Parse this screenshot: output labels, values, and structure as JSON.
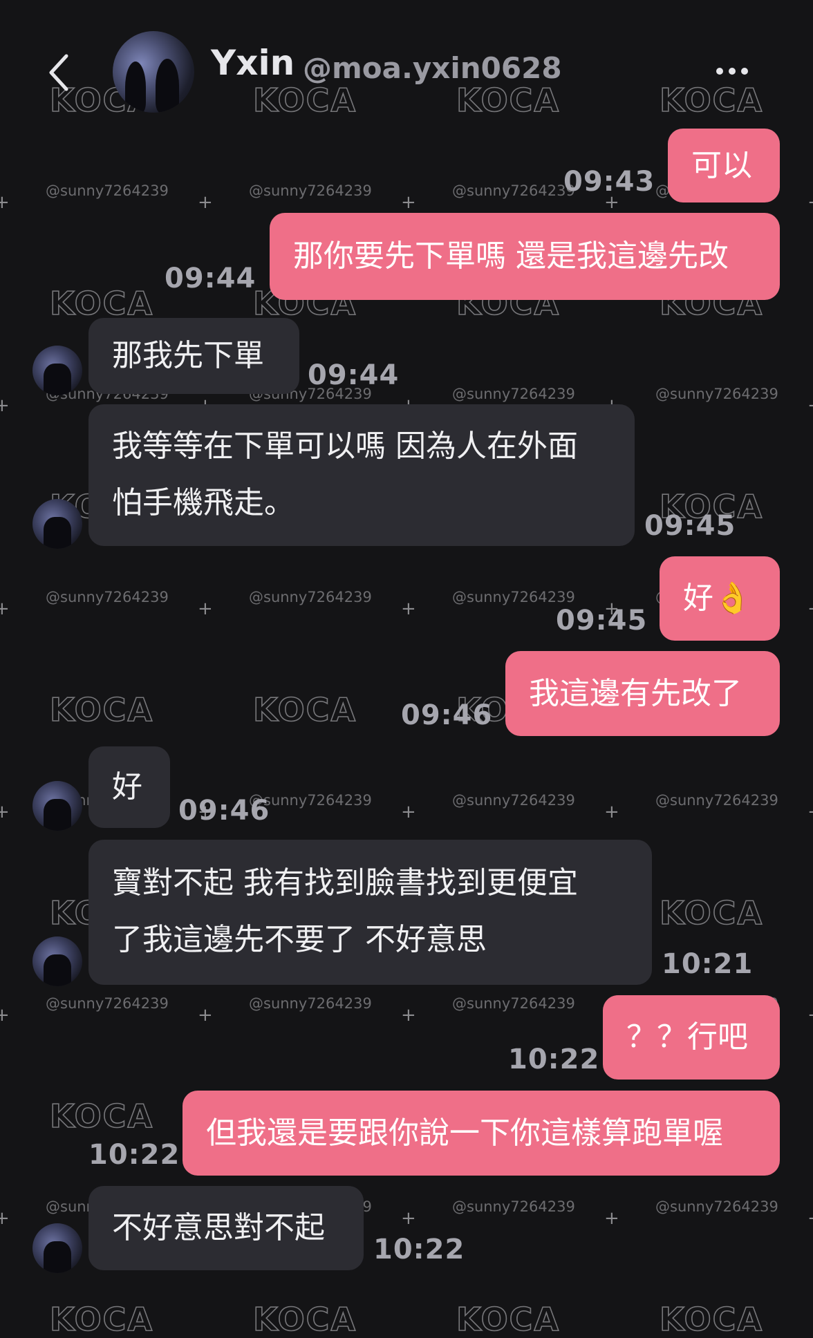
{
  "header": {
    "contact_name": "Yxin",
    "contact_handle": "@moa.yxin0628",
    "back_icon": "chevron-left-icon",
    "more_icon": "more-horizontal-icon"
  },
  "watermark": {
    "logo": "KOCA",
    "handle": "@sunny7264239"
  },
  "messages": [
    {
      "direction": "outgoing",
      "text": "可以",
      "time": "09:43"
    },
    {
      "direction": "outgoing",
      "text": "那你要先下單嗎 還是我這邊先改",
      "time": "09:44"
    },
    {
      "direction": "incoming",
      "text": "那我先下單",
      "time": "09:44"
    },
    {
      "direction": "incoming",
      "lines": [
        "我等等在下單可以嗎 因為人在外面",
        "怕手機飛走。"
      ],
      "time": "09:45"
    },
    {
      "direction": "outgoing",
      "text": "好👌",
      "time": "09:45"
    },
    {
      "direction": "outgoing",
      "text": "我這邊有先改了",
      "time": "09:46"
    },
    {
      "direction": "incoming",
      "text": "好",
      "time": "09:46"
    },
    {
      "direction": "incoming",
      "lines": [
        "寶對不起 我有找到臉書找到更便宜",
        "了我這邊先不要了 不好意思"
      ],
      "time": "10:21"
    },
    {
      "direction": "outgoing",
      "text": "？？行吧",
      "time": "10:22"
    },
    {
      "direction": "outgoing",
      "text": "但我還是要跟你說一下你這樣算跑單喔",
      "time": "10:22"
    },
    {
      "direction": "incoming",
      "text": "不好意思對不起",
      "time": "10:22"
    }
  ],
  "colors": {
    "background": "#141416",
    "outgoing_bubble": "#ef6f88",
    "incoming_bubble": "#2c2c32",
    "timestamp": "#a6a6ae"
  }
}
